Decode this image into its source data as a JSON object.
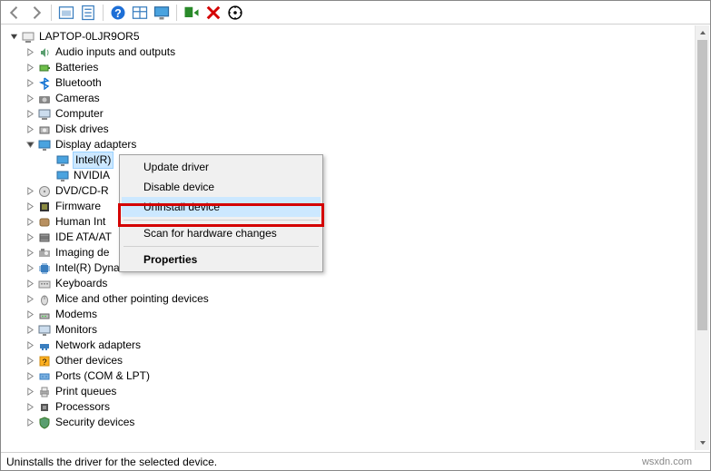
{
  "toolbar": {
    "back": "back",
    "forward": "forward",
    "show_hidden": "show-hidden",
    "properties_secondary": "properties-page",
    "help": "help",
    "view_grid": "view-grid",
    "monitor": "monitor",
    "monitor_x": "monitor-remove",
    "remove": "remove",
    "scan": "scan"
  },
  "root": {
    "label": "LAPTOP-0LJR9OR5"
  },
  "categories": [
    {
      "label": "Audio inputs and outputs",
      "icon": "audio",
      "expandable": true
    },
    {
      "label": "Batteries",
      "icon": "battery",
      "expandable": true
    },
    {
      "label": "Bluetooth",
      "icon": "bluetooth",
      "expandable": true
    },
    {
      "label": "Cameras",
      "icon": "camera",
      "expandable": true
    },
    {
      "label": "Computer",
      "icon": "computer",
      "expandable": true
    },
    {
      "label": "Disk drives",
      "icon": "disk",
      "expandable": true
    },
    {
      "label": "Display adapters",
      "icon": "display",
      "expandable": true,
      "open": true,
      "children": [
        {
          "label": "Intel(R)",
          "icon": "display",
          "selected": true
        },
        {
          "label": "NVIDIA",
          "icon": "display"
        }
      ]
    },
    {
      "label": "DVD/CD-R",
      "icon": "dvd",
      "expandable": true
    },
    {
      "label": "Firmware",
      "icon": "firmware",
      "expandable": true
    },
    {
      "label": "Human Int",
      "icon": "hid",
      "expandable": true
    },
    {
      "label": "IDE ATA/AT",
      "icon": "ide",
      "expandable": true
    },
    {
      "label": "Imaging de",
      "icon": "imaging",
      "expandable": true
    },
    {
      "label": "Intel(R) Dynamic Platform and Thermal Framework",
      "icon": "chip",
      "expandable": true
    },
    {
      "label": "Keyboards",
      "icon": "keyboard",
      "expandable": true
    },
    {
      "label": "Mice and other pointing devices",
      "icon": "mouse",
      "expandable": true
    },
    {
      "label": "Modems",
      "icon": "modem",
      "expandable": true
    },
    {
      "label": "Monitors",
      "icon": "monitors",
      "expandable": true
    },
    {
      "label": "Network adapters",
      "icon": "network",
      "expandable": true
    },
    {
      "label": "Other devices",
      "icon": "other",
      "expandable": true
    },
    {
      "label": "Ports (COM & LPT)",
      "icon": "ports",
      "expandable": true
    },
    {
      "label": "Print queues",
      "icon": "printer",
      "expandable": true
    },
    {
      "label": "Processors",
      "icon": "processor",
      "expandable": true
    },
    {
      "label": "Security devices",
      "icon": "security",
      "expandable": true
    }
  ],
  "context_menu": {
    "update": "Update driver",
    "disable": "Disable device",
    "uninstall": "Uninstall device",
    "scan": "Scan for hardware changes",
    "properties": "Properties"
  },
  "status": "Uninstalls the driver for the selected device.",
  "watermark": "wsxdn.com"
}
